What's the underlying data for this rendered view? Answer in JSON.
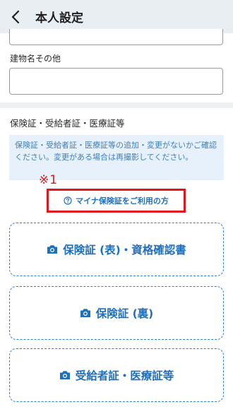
{
  "header": {
    "title": "本人設定"
  },
  "address": {
    "building_label": "建物名その他"
  },
  "insurance": {
    "section_title": "保険証・受給者証・医療証等",
    "notice": "保険証・受給者証・医療証等の追加・変更がないかご確認ください。変更がある場合は再撮影してください。",
    "annotation": "※1",
    "mynah_link": "マイナ保険証をご利用の方",
    "uploads": [
      {
        "label": "保険証 (表)・資格確認書"
      },
      {
        "label": "保険証 (裏)"
      },
      {
        "label": "受給者証・医療証等"
      }
    ]
  },
  "colors": {
    "accent": "#1f6fbf",
    "annotation": "#e3141b",
    "notice_bg": "#e6f1fb"
  }
}
